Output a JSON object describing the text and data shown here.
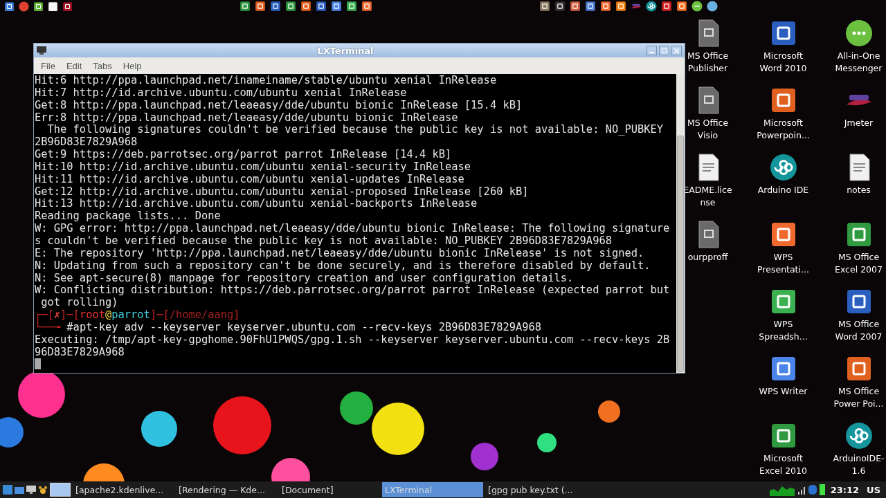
{
  "top_panel": {
    "launchers": [
      {
        "kind": "files"
      },
      {
        "kind": "chrome"
      },
      {
        "kind": "leaf"
      },
      {
        "kind": "flag"
      },
      {
        "kind": "redapp"
      }
    ],
    "center_apps": [
      {
        "kind": "excel"
      },
      {
        "kind": "ppt"
      },
      {
        "kind": "word"
      },
      {
        "kind": "excel"
      },
      {
        "kind": "ppt"
      },
      {
        "kind": "word"
      },
      {
        "kind": "wpsw"
      },
      {
        "kind": "wpss"
      },
      {
        "kind": "wpsp"
      }
    ],
    "right_apps": [
      {
        "kind": "gimp"
      },
      {
        "kind": "inkscape"
      },
      {
        "kind": "box"
      },
      {
        "kind": "window"
      },
      {
        "kind": "wpsp"
      },
      {
        "kind": "vlc"
      },
      {
        "kind": "jmeter"
      },
      {
        "kind": "arduino"
      },
      {
        "kind": "red"
      },
      {
        "kind": "fox"
      },
      {
        "kind": "messenger"
      },
      {
        "kind": "globe"
      }
    ]
  },
  "window": {
    "title": "LXTerminal",
    "menu": [
      "File",
      "Edit",
      "Tabs",
      "Help"
    ],
    "lines": [
      {
        "kind": "text",
        "text": "Hit:6 http://ppa.launchpad.net/inameiname/stable/ubuntu xenial InRelease"
      },
      {
        "kind": "text",
        "text": "Hit:7 http://id.archive.ubuntu.com/ubuntu xenial InRelease"
      },
      {
        "kind": "text",
        "text": "Get:8 http://ppa.launchpad.net/leaeasy/dde/ubuntu bionic InRelease [15.4 kB]"
      },
      {
        "kind": "text",
        "text": "Err:8 http://ppa.launchpad.net/leaeasy/dde/ubuntu bionic InRelease"
      },
      {
        "kind": "text",
        "text": "  The following signatures couldn't be verified because the public key is not available: NO_PUBKEY"
      },
      {
        "kind": "text",
        "text": "2B96D83E7829A968"
      },
      {
        "kind": "text",
        "text": "Get:9 https://deb.parrotsec.org/parrot parrot InRelease [14.4 kB]"
      },
      {
        "kind": "text",
        "text": "Hit:10 http://id.archive.ubuntu.com/ubuntu xenial-security InRelease"
      },
      {
        "kind": "text",
        "text": "Hit:11 http://id.archive.ubuntu.com/ubuntu xenial-updates InRelease"
      },
      {
        "kind": "text",
        "text": "Get:12 http://id.archive.ubuntu.com/ubuntu xenial-proposed InRelease [260 kB]"
      },
      {
        "kind": "text",
        "text": "Hit:13 http://id.archive.ubuntu.com/ubuntu xenial-backports InRelease"
      },
      {
        "kind": "text",
        "text": "Reading package lists... Done"
      },
      {
        "kind": "text",
        "text": "W: GPG error: http://ppa.launchpad.net/leaeasy/dde/ubuntu bionic InRelease: The following signature"
      },
      {
        "kind": "text",
        "text": "s couldn't be verified because the public key is not available: NO_PUBKEY 2B96D83E7829A968"
      },
      {
        "kind": "text",
        "text": "E: The repository 'http://ppa.launchpad.net/leaeasy/dde/ubuntu bionic InRelease' is not signed."
      },
      {
        "kind": "text",
        "text": "N: Updating from such a repository can't be done securely, and is therefore disabled by default."
      },
      {
        "kind": "text",
        "text": "N: See apt-secure(8) manpage for repository creation and user configuration details."
      },
      {
        "kind": "text",
        "text": "W: Conflicting distribution: https://deb.parrotsec.org/parrot parrot InRelease (expected parrot but"
      },
      {
        "kind": "text",
        "text": " got rolling)"
      },
      {
        "kind": "prompt",
        "parts": [
          {
            "text": "┌─[",
            "color": "#cc2222"
          },
          {
            "text": "✗",
            "color": "#ee4444"
          },
          {
            "text": "]─[",
            "color": "#cc2222"
          },
          {
            "text": "root",
            "color": "#ee3333"
          },
          {
            "text": "@",
            "color": "#f0d040"
          },
          {
            "text": "parrot",
            "color": "#40d0e0"
          },
          {
            "text": "]─[",
            "color": "#cc2222"
          },
          {
            "text": "/home/aang",
            "color": "#a02020"
          },
          {
            "text": "]",
            "color": "#cc2222"
          }
        ]
      },
      {
        "kind": "prompt",
        "parts": [
          {
            "text": "└──╼ ",
            "color": "#cc2222"
          },
          {
            "text": "#apt-key adv --keyserver keyserver.ubuntu.com --recv-keys 2B96D83E7829A968",
            "color": "#e8e8e8"
          }
        ]
      },
      {
        "kind": "text",
        "text": "Executing: /tmp/apt-key-gpghome.90FhU1PWQS/gpg.1.sh --keyserver keyserver.ubuntu.com --recv-keys 2B"
      },
      {
        "kind": "text",
        "text": "96D83E7829A968"
      },
      {
        "kind": "cursor"
      }
    ]
  },
  "desktop_icons": [
    [
      {
        "kind": "generic",
        "label": [
          "MS Office",
          "Publisher"
        ]
      },
      {
        "kind": "generic",
        "label": [
          "MS Office",
          "Visio"
        ]
      },
      {
        "kind": "textfile",
        "label": [
          "EADME.lice",
          "nse"
        ]
      },
      {
        "kind": "generic",
        "label": [
          "ourpproff"
        ]
      }
    ],
    [
      {
        "kind": "word",
        "label": [
          "Microsoft",
          "Word 2010"
        ]
      },
      {
        "kind": "ppt",
        "label": [
          "Microsoft",
          "Powerpoin..."
        ]
      },
      {
        "kind": "arduino",
        "label": [
          "Arduino IDE"
        ]
      },
      {
        "kind": "wpsp",
        "label": [
          "WPS",
          "Presentati..."
        ]
      },
      {
        "kind": "wpss",
        "label": [
          "WPS",
          "Spreadsh..."
        ]
      },
      {
        "kind": "wpsw",
        "label": [
          "WPS Writer"
        ]
      },
      {
        "kind": "excel",
        "label": [
          "Microsoft",
          "Excel 2010"
        ]
      }
    ],
    [
      {
        "kind": "messenger",
        "label": [
          "All-in-One",
          "Messenger"
        ]
      },
      {
        "kind": "jmeter",
        "label": [
          "Jmeter"
        ]
      },
      {
        "kind": "textfile",
        "label": [
          "notes"
        ]
      },
      {
        "kind": "excel",
        "label": [
          "MS Office",
          "Excel 2007"
        ]
      },
      {
        "kind": "word",
        "label": [
          "MS Office",
          "Word 2007"
        ]
      },
      {
        "kind": "ppt",
        "label": [
          "MS Office",
          "Power Poi..."
        ]
      },
      {
        "kind": "arduino",
        "label": [
          "ArduinoIDE-",
          "1.6"
        ]
      }
    ]
  ],
  "taskbar": {
    "tasks": [
      {
        "label": "[apache2.kdenlive...",
        "selected": false
      },
      {
        "label": "[Rendering — Kde...",
        "selected": false
      },
      {
        "label": "[Document]",
        "selected": false
      },
      {
        "label": "LXTerminal",
        "selected": true
      },
      {
        "label": "[gpg pub key.txt (...",
        "selected": false
      }
    ],
    "clock": "23:12",
    "keyboard": "US"
  }
}
